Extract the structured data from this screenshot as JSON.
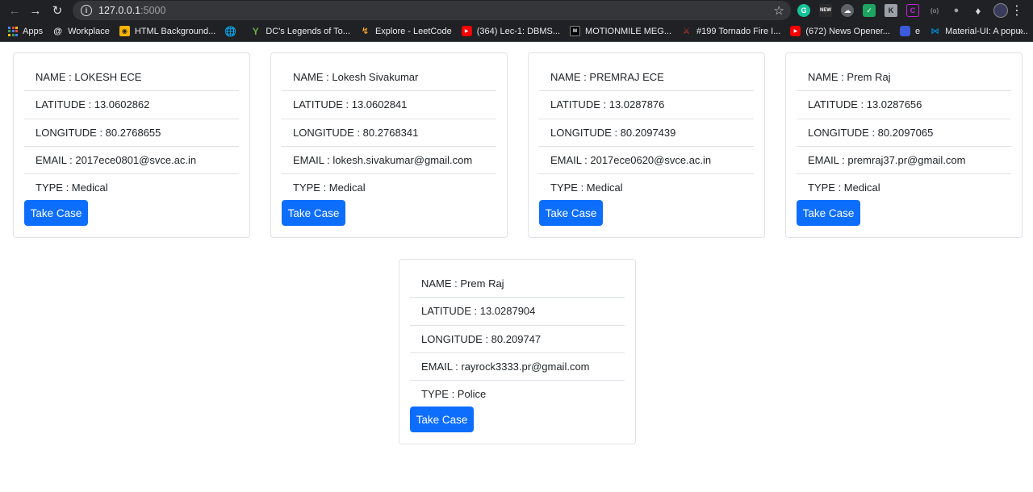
{
  "browser": {
    "url_host": "127.0.0.1",
    "url_port": ":5000",
    "bookmarks": [
      {
        "label": "Apps",
        "icon": "apps-grid-icon",
        "color": ""
      },
      {
        "label": "Workplace",
        "icon": "at-icon",
        "color": ""
      },
      {
        "label": "HTML Background...",
        "icon": "html-bg-icon",
        "color": "#f5b400"
      },
      {
        "label": "",
        "icon": "globe-icon",
        "color": "#dadce0"
      },
      {
        "label": "DC's Legends of To...",
        "icon": "y-icon",
        "color": "#6ab04c"
      },
      {
        "label": "Explore - LeetCode",
        "icon": "leetcode-icon",
        "color": "#f89f1b"
      },
      {
        "label": "(364) Lec-1: DBMS...",
        "icon": "youtube-icon",
        "color": "#ff0000"
      },
      {
        "label": "MOTIONMILE MEG...",
        "icon": "motionmile-icon",
        "color": "#000000"
      },
      {
        "label": "#199 Tornado Fire I...",
        "icon": "tornado-icon",
        "color": "#c0392b"
      },
      {
        "label": "(672) News Opener...",
        "icon": "youtube-icon",
        "color": "#ff0000"
      },
      {
        "label": "e",
        "icon": "bookmark-blue-icon",
        "color": "#3b5bdb"
      },
      {
        "label": "Material-UI: A popu...",
        "icon": "material-ui-icon",
        "color": "#0081cb"
      }
    ],
    "more_label": "»"
  },
  "cases": [
    {
      "name": "NAME : LOKESH ECE",
      "latitude": "LATITUDE : 13.0602862",
      "longitude": "LONGITUDE : 80.2768655",
      "email": "EMAIL : 2017ece0801@svce.ac.in",
      "type": "TYPE : Medical",
      "button": "Take Case"
    },
    {
      "name": "NAME : Lokesh Sivakumar",
      "latitude": "LATITUDE : 13.0602841",
      "longitude": "LONGITUDE : 80.2768341",
      "email": "EMAIL : lokesh.sivakumar@gmail.com",
      "type": "TYPE : Medical",
      "button": "Take Case"
    },
    {
      "name": "NAME : PREMRAJ ECE",
      "latitude": "LATITUDE : 13.0287876",
      "longitude": "LONGITUDE : 80.2097439",
      "email": "EMAIL : 2017ece0620@svce.ac.in",
      "type": "TYPE : Medical",
      "button": "Take Case"
    },
    {
      "name": "NAME : Prem Raj",
      "latitude": "LATITUDE : 13.0287656",
      "longitude": "LONGITUDE : 80.2097065",
      "email": "EMAIL : premraj37.pr@gmail.com",
      "type": "TYPE : Medical",
      "button": "Take Case"
    },
    {
      "name": "NAME : Prem Raj",
      "latitude": "LATITUDE : 13.0287904",
      "longitude": "LONGITUDE : 80.209747",
      "email": "EMAIL : rayrock3333.pr@gmail.com",
      "type": "TYPE : Police",
      "button": "Take Case"
    }
  ],
  "colors": {
    "primary_button": "#0d6efd",
    "border": "#dee2e6",
    "browser_bg": "#202124"
  }
}
